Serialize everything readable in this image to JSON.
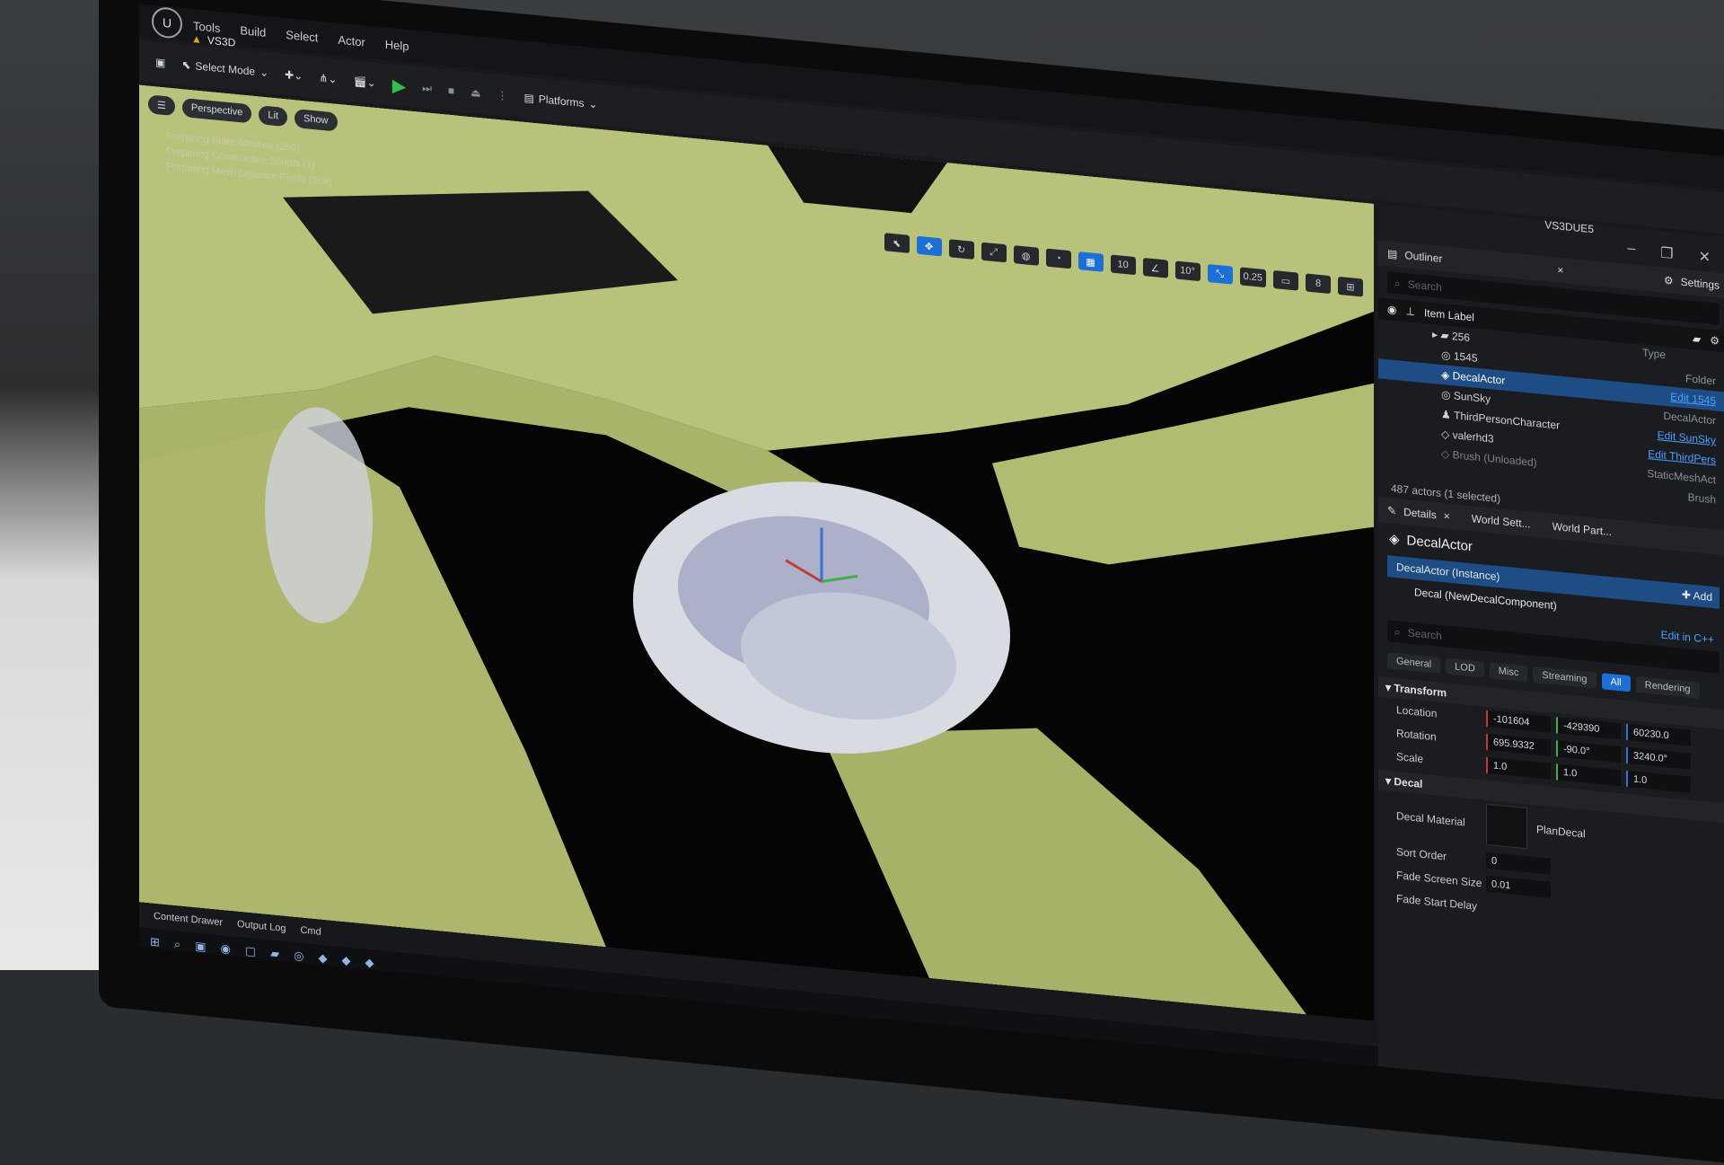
{
  "window": {
    "project_tab": "VS3D",
    "title": "VS3DUE5"
  },
  "menu": [
    "Tools",
    "Build",
    "Select",
    "Actor",
    "Help"
  ],
  "toolbar": {
    "select_mode": "Select Mode",
    "platforms": "Platforms"
  },
  "viewport": {
    "perspective": "Perspective",
    "lit": "Lit",
    "show": "Show",
    "messages": [
      "Preparing Static Meshes (250)",
      "Preparing Construction Scripts (1)",
      "Preparing Mesh Distance Fields (108)"
    ],
    "grid_snap": "10",
    "rot_snap": "10°",
    "scale_snap": "0.25",
    "cam_speed": "8"
  },
  "bottom_bar": {
    "content_drawer": "Content Drawer",
    "output_log": "Output Log",
    "cmd": "Cmd"
  },
  "outliner": {
    "tab": "Outliner",
    "settings": "Settings",
    "search_placeholder": "Search",
    "col_label": "Item Label",
    "col_type": "Type",
    "items": [
      {
        "label": "256",
        "type": "Folder",
        "link": false
      },
      {
        "label": "1545",
        "type": "Edit 1545",
        "link": true
      },
      {
        "label": "DecalActor",
        "type": "DecalActor",
        "link": false
      },
      {
        "label": "SunSky",
        "type": "Edit SunSky",
        "link": true
      },
      {
        "label": "ThirdPersonCharacter",
        "type": "Edit ThirdPers",
        "link": true
      },
      {
        "label": "valerhd3",
        "type": "StaticMeshAct",
        "link": false
      },
      {
        "label": "Brush (Unloaded)",
        "type": "Brush",
        "link": false
      }
    ],
    "status": "487 actors (1 selected)"
  },
  "details": {
    "tab": "Details",
    "tab2": "World Sett...",
    "tab3": "World Part...",
    "name": "DecalActor",
    "add": "Add",
    "instance": "DecalActor (Instance)",
    "component": "Decal (NewDecalComponent)",
    "edit_cpp": "Edit in C++",
    "search_placeholder": "Search",
    "filters": [
      "General",
      "LOD",
      "Misc",
      "Streaming",
      "All",
      "Rendering"
    ],
    "transform": {
      "title": "Transform",
      "location_label": "Location",
      "rotation_label": "Rotation",
      "scale_label": "Scale",
      "location": [
        "-101604",
        "-429390",
        "60230.0"
      ],
      "rotation": [
        "695.9332",
        "-90.0°",
        "3240.0°"
      ],
      "scale": [
        "1.0",
        "1.0",
        "1.0"
      ]
    },
    "decal": {
      "title": "Decal",
      "material_label": "Decal Material",
      "material": "PlanDecal",
      "sort_label": "Sort Order",
      "sort": "0",
      "fade_size_label": "Fade Screen Size",
      "fade_size": "0.01",
      "fade_delay_label": "Fade Start Delay"
    }
  }
}
